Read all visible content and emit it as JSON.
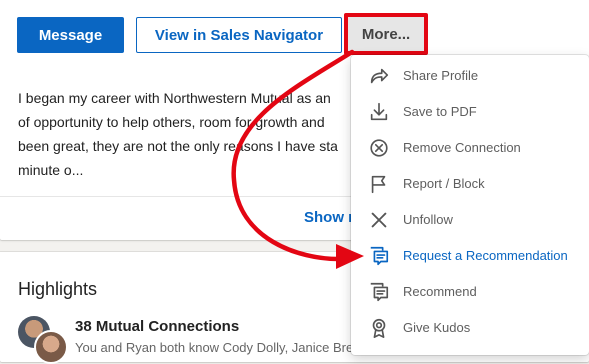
{
  "actions": {
    "message_label": "Message",
    "sales_navigator_label": "View in Sales Navigator",
    "more_label": "More..."
  },
  "about": {
    "text": "I began my career with Northwestern Mutual as an\nof opportunity to help others, room for growth and\nbeen great, they are not the only reasons I have sta\nminute o...",
    "show_more_label": "Show m"
  },
  "more_menu": {
    "items": [
      {
        "label": "Share Profile",
        "icon": "share-arrow-icon"
      },
      {
        "label": "Save to PDF",
        "icon": "download-icon"
      },
      {
        "label": "Remove Connection",
        "icon": "remove-circle-icon"
      },
      {
        "label": "Report / Block",
        "icon": "flag-icon"
      },
      {
        "label": "Unfollow",
        "icon": "x-icon"
      },
      {
        "label": "Request a Recommendation",
        "icon": "speech-bubble-icon"
      },
      {
        "label": "Recommend",
        "icon": "speech-bubble-icon"
      },
      {
        "label": "Give Kudos",
        "icon": "medal-icon"
      }
    ]
  },
  "highlights": {
    "title": "Highlights",
    "mutual_title": "38 Mutual Connections",
    "mutual_subtitle": "You and Ryan both know Cody Dolly, Janice Bre"
  },
  "colors": {
    "linkedin_blue": "#0a66c2",
    "annotation_red": "#e30613"
  }
}
